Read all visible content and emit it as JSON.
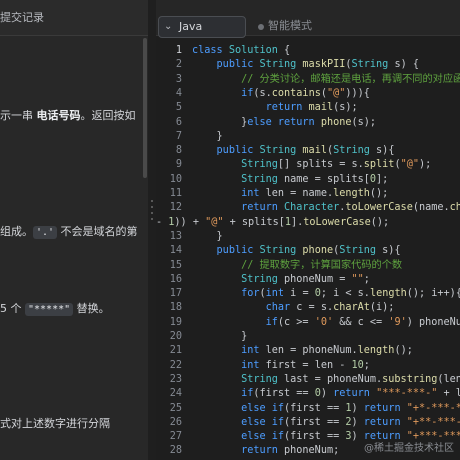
{
  "left": {
    "tab_label": "提交记录",
    "lines": [
      {
        "pre": "示一串 ",
        "bold": "电话号码",
        "post": "。返回按如"
      },
      {
        "pre": "组成。",
        "code": "'.'",
        "post": " 不会是域名的第"
      },
      {
        "pre": "5 个 ",
        "code": "\"*****\"",
        "post": " 替换。"
      },
      {
        "pre": "式对上述数字进行分隔",
        "bold": "",
        "post": ""
      }
    ]
  },
  "editor": {
    "language": "Java",
    "mode_label": "智能模式",
    "lines": [
      {
        "n": "1",
        "tokens": [
          [
            "kw",
            "class "
          ],
          [
            "ty",
            "Solution"
          ],
          [
            "pl",
            " {"
          ]
        ]
      },
      {
        "n": "2",
        "tokens": [
          [
            "pl",
            "    "
          ],
          [
            "kw",
            "public "
          ],
          [
            "ty",
            "String "
          ],
          [
            "fn",
            "maskPII"
          ],
          [
            "pl",
            "("
          ],
          [
            "ty",
            "String "
          ],
          [
            "pl",
            "s) {"
          ]
        ]
      },
      {
        "n": "3",
        "tokens": [
          [
            "pl",
            "        "
          ],
          [
            "cm",
            "// 分类讨论，邮箱还是电话，再调不同的对应函数"
          ]
        ]
      },
      {
        "n": "4",
        "tokens": [
          [
            "pl",
            "        "
          ],
          [
            "kw",
            "if"
          ],
          [
            "pl",
            "(s."
          ],
          [
            "fn",
            "contains"
          ],
          [
            "pl",
            "("
          ],
          [
            "st",
            "\"@\""
          ],
          [
            "pl",
            "))){"
          ]
        ]
      },
      {
        "n": "5",
        "tokens": [
          [
            "pl",
            "            "
          ],
          [
            "kw",
            "return "
          ],
          [
            "fn",
            "mail"
          ],
          [
            "pl",
            "(s);"
          ]
        ]
      },
      {
        "n": "6",
        "tokens": [
          [
            "pl",
            "        }"
          ],
          [
            "kw",
            "else return "
          ],
          [
            "fn",
            "phone"
          ],
          [
            "pl",
            "(s);"
          ]
        ]
      },
      {
        "n": "7",
        "tokens": [
          [
            "pl",
            "    }"
          ]
        ]
      },
      {
        "n": "8",
        "tokens": [
          [
            "pl",
            "    "
          ],
          [
            "kw",
            "public "
          ],
          [
            "ty",
            "String "
          ],
          [
            "fn",
            "mail"
          ],
          [
            "pl",
            "("
          ],
          [
            "ty",
            "String "
          ],
          [
            "pl",
            "s){"
          ]
        ]
      },
      {
        "n": "9",
        "tokens": [
          [
            "pl",
            "        "
          ],
          [
            "ty",
            "String"
          ],
          [
            "pl",
            "[] splits = s."
          ],
          [
            "fn",
            "split"
          ],
          [
            "pl",
            "("
          ],
          [
            "st",
            "\"@\""
          ],
          [
            "pl",
            ");"
          ]
        ]
      },
      {
        "n": "10",
        "tokens": [
          [
            "pl",
            "        "
          ],
          [
            "ty",
            "String "
          ],
          [
            "pl",
            "name = splits["
          ],
          [
            "nm",
            "0"
          ],
          [
            "pl",
            "];"
          ]
        ]
      },
      {
        "n": "11",
        "tokens": [
          [
            "pl",
            "        "
          ],
          [
            "kw",
            "int "
          ],
          [
            "pl",
            "len = name."
          ],
          [
            "fn",
            "length"
          ],
          [
            "pl",
            "();"
          ]
        ]
      },
      {
        "n": "12",
        "tokens": [
          [
            "pl",
            "        "
          ],
          [
            "kw",
            "return "
          ],
          [
            "ty",
            "Character"
          ],
          [
            "pl",
            "."
          ],
          [
            "fn",
            "toLowerCase"
          ],
          [
            "pl",
            "(name."
          ],
          [
            "fn",
            "charAt"
          ],
          [
            "pl",
            "("
          ]
        ]
      },
      {
        "n": "",
        "tokens": [
          [
            "pl",
            "- "
          ],
          [
            "nm",
            "1"
          ],
          [
            "pl",
            ")) + "
          ],
          [
            "st",
            "\"@\""
          ],
          [
            "pl",
            " + splits["
          ],
          [
            "nm",
            "1"
          ],
          [
            "pl",
            "]."
          ],
          [
            "fn",
            "toLowerCase"
          ],
          [
            "pl",
            "();"
          ]
        ]
      },
      {
        "n": "13",
        "tokens": [
          [
            "pl",
            "    }"
          ]
        ]
      },
      {
        "n": "14",
        "tokens": [
          [
            "pl",
            "    "
          ],
          [
            "kw",
            "public "
          ],
          [
            "ty",
            "String "
          ],
          [
            "fn",
            "phone"
          ],
          [
            "pl",
            "("
          ],
          [
            "ty",
            "String "
          ],
          [
            "pl",
            "s){"
          ]
        ]
      },
      {
        "n": "15",
        "tokens": [
          [
            "pl",
            "        "
          ],
          [
            "cm",
            "// 提取数字，计算国家代码的个数"
          ]
        ]
      },
      {
        "n": "16",
        "tokens": [
          [
            "pl",
            "        "
          ],
          [
            "ty",
            "String "
          ],
          [
            "pl",
            "phoneNum = "
          ],
          [
            "st",
            "\"\""
          ],
          [
            "pl",
            ";"
          ]
        ]
      },
      {
        "n": "17",
        "tokens": [
          [
            "pl",
            "        "
          ],
          [
            "kw",
            "for"
          ],
          [
            "pl",
            "("
          ],
          [
            "kw",
            "int "
          ],
          [
            "pl",
            "i = "
          ],
          [
            "nm",
            "0"
          ],
          [
            "pl",
            "; i < s."
          ],
          [
            "fn",
            "length"
          ],
          [
            "pl",
            "(); i++){"
          ]
        ]
      },
      {
        "n": "18",
        "tokens": [
          [
            "pl",
            "            "
          ],
          [
            "kw",
            "char "
          ],
          [
            "pl",
            "c = s."
          ],
          [
            "fn",
            "charAt"
          ],
          [
            "pl",
            "(i);"
          ]
        ]
      },
      {
        "n": "19",
        "tokens": [
          [
            "pl",
            "            "
          ],
          [
            "kw",
            "if"
          ],
          [
            "pl",
            "(c >= "
          ],
          [
            "st",
            "'0'"
          ],
          [
            "pl",
            " && c <= "
          ],
          [
            "st",
            "'9'"
          ],
          [
            "pl",
            ") phoneNum +="
          ]
        ]
      },
      {
        "n": "20",
        "tokens": [
          [
            "pl",
            "        }"
          ]
        ]
      },
      {
        "n": "21",
        "tokens": [
          [
            "pl",
            "        "
          ],
          [
            "kw",
            "int "
          ],
          [
            "pl",
            "len = phoneNum."
          ],
          [
            "fn",
            "length"
          ],
          [
            "pl",
            "();"
          ]
        ]
      },
      {
        "n": "22",
        "tokens": [
          [
            "pl",
            "        "
          ],
          [
            "kw",
            "int "
          ],
          [
            "pl",
            "first = len - "
          ],
          [
            "nm",
            "10"
          ],
          [
            "pl",
            ";"
          ]
        ]
      },
      {
        "n": "23",
        "tokens": [
          [
            "pl",
            "        "
          ],
          [
            "ty",
            "String "
          ],
          [
            "pl",
            "last = phoneNum."
          ],
          [
            "fn",
            "substring"
          ],
          [
            "pl",
            "(len - "
          ],
          [
            "nm",
            "4"
          ],
          [
            "pl",
            ")"
          ]
        ]
      },
      {
        "n": "24",
        "tokens": [
          [
            "pl",
            "        "
          ],
          [
            "kw",
            "if"
          ],
          [
            "pl",
            "(first == "
          ],
          [
            "nm",
            "0"
          ],
          [
            "pl",
            ") "
          ],
          [
            "kw",
            "return "
          ],
          [
            "st",
            "\"***-***-\""
          ],
          [
            "pl",
            " + last;"
          ]
        ]
      },
      {
        "n": "25",
        "tokens": [
          [
            "pl",
            "        "
          ],
          [
            "kw",
            "else if"
          ],
          [
            "pl",
            "(first == "
          ],
          [
            "nm",
            "1"
          ],
          [
            "pl",
            ") "
          ],
          [
            "kw",
            "return "
          ],
          [
            "st",
            "\"+*-***-***-\""
          ]
        ]
      },
      {
        "n": "26",
        "tokens": [
          [
            "pl",
            "        "
          ],
          [
            "kw",
            "else if"
          ],
          [
            "pl",
            "(first == "
          ],
          [
            "nm",
            "2"
          ],
          [
            "pl",
            ") "
          ],
          [
            "kw",
            "return "
          ],
          [
            "st",
            "\"+**-***-***-\""
          ]
        ]
      },
      {
        "n": "27",
        "tokens": [
          [
            "pl",
            "        "
          ],
          [
            "kw",
            "else if"
          ],
          [
            "pl",
            "(first == "
          ],
          [
            "nm",
            "3"
          ],
          [
            "pl",
            ") "
          ],
          [
            "kw",
            "return "
          ],
          [
            "st",
            "\"+***-***-***-\""
          ]
        ]
      },
      {
        "n": "28",
        "tokens": [
          [
            "pl",
            "        "
          ],
          [
            "kw",
            "return "
          ],
          [
            "pl",
            "phoneNum;"
          ]
        ]
      },
      {
        "n": "29",
        "tokens": [
          [
            "pl",
            "    }"
          ]
        ]
      }
    ]
  },
  "watermark": "@稀土掘金技术社区"
}
